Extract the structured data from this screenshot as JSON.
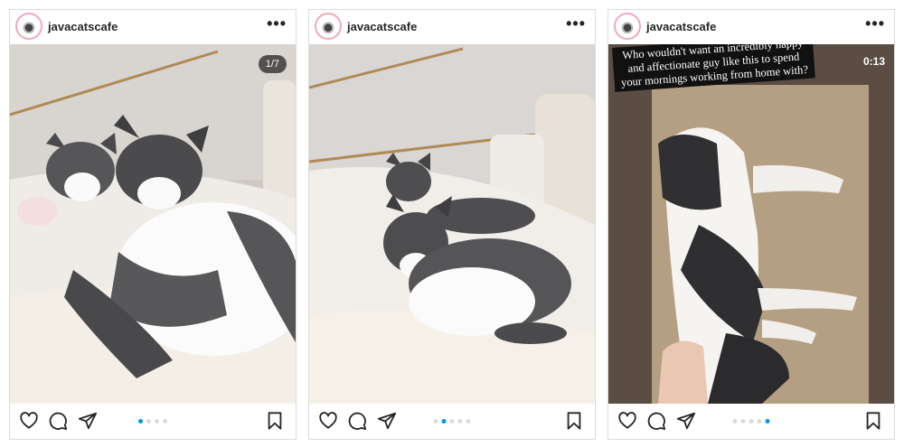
{
  "posts": [
    {
      "username": "javacatscafe",
      "more_label": "•••",
      "media_badge": "1/7",
      "dots": [
        true,
        false,
        false,
        false,
        false
      ]
    },
    {
      "username": "javacatscafe",
      "more_label": "•••",
      "dots": [
        false,
        true,
        false,
        false,
        false
      ]
    },
    {
      "username": "javacatscafe",
      "more_label": "•••",
      "media_badge": "0:13",
      "caption": "Who wouldn't want an incredibly happy and affectionate guy like this to spend your mornings working from home with?",
      "dots": [
        false,
        false,
        false,
        false,
        true
      ]
    }
  ],
  "icons": [
    "heart-icon",
    "comment-icon",
    "share-icon",
    "bookmark-icon"
  ],
  "colors": {
    "accent": "#0095f6",
    "border": "#dbdbdb",
    "text": "#262626"
  }
}
